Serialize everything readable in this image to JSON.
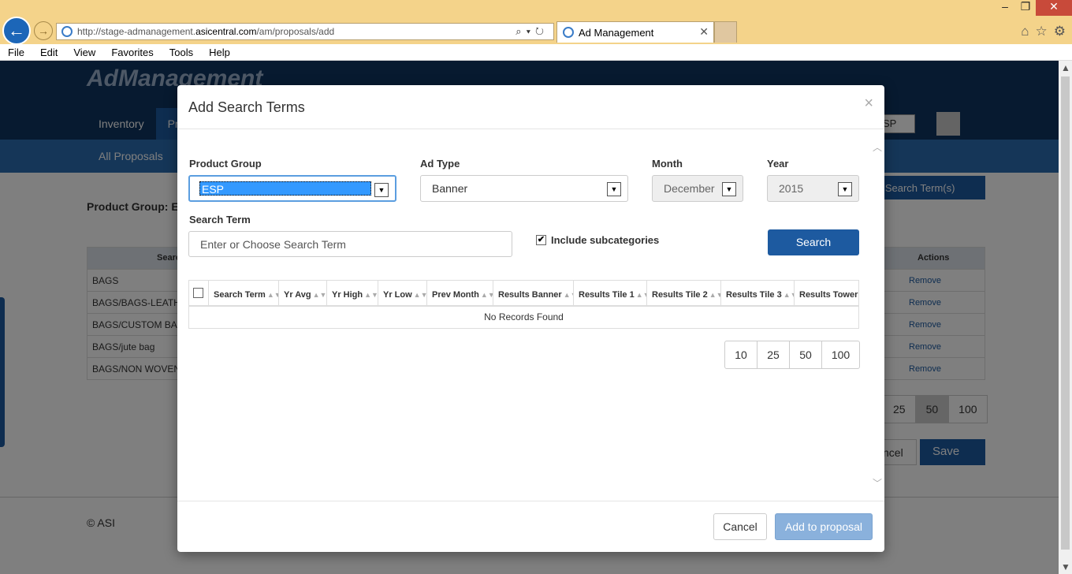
{
  "browser": {
    "url_prefix": "http://stage-admanagement.",
    "url_domain": "asicentral.com",
    "url_path": "/am/proposals/add",
    "tab_title": "Ad Management",
    "menu": [
      "File",
      "Edit",
      "View",
      "Favorites",
      "Tools",
      "Help"
    ]
  },
  "page": {
    "logo": "AdManagement",
    "nav": [
      "Inventory",
      "Pr"
    ],
    "subnav": "All Proposals",
    "user_select": "SP",
    "add_terms_button": "d Search Term(s)",
    "product_group_label": "Product Group: E",
    "table_header": "Search",
    "actions_header": "Actions",
    "rows": [
      "BAGS",
      "BAGS/BAGS-LEATH",
      "BAGS/CUSTOM BA",
      "BAGS/jute bag",
      "BAGS/NON WOVEN"
    ],
    "remove_label": "Remove",
    "pager": [
      "25",
      "50",
      "100"
    ],
    "cancel_label": "ncel",
    "save_label": "Save",
    "footer": "© ASI"
  },
  "modal": {
    "title": "Add Search Terms",
    "close": "×",
    "product_group": {
      "label": "Product Group",
      "value": "ESP"
    },
    "ad_type": {
      "label": "Ad Type",
      "value": "Banner"
    },
    "month": {
      "label": "Month",
      "value": "December"
    },
    "year": {
      "label": "Year",
      "value": "2015"
    },
    "search_term": {
      "label": "Search Term",
      "placeholder": "Enter or Choose Search Term"
    },
    "include_subcategories": {
      "label": "Include subcategories",
      "checked": true
    },
    "search_button": "Search",
    "columns": [
      "Search Term",
      "Yr Avg",
      "Yr High",
      "Yr Low",
      "Prev Month",
      "Results Banner",
      "Results Tile 1",
      "Results Tile 2",
      "Results Tile 3",
      "Results Tower"
    ],
    "no_records": "No Records Found",
    "page_sizes": [
      "10",
      "25",
      "50",
      "100"
    ],
    "cancel_button": "Cancel",
    "add_button": "Add to proposal"
  }
}
